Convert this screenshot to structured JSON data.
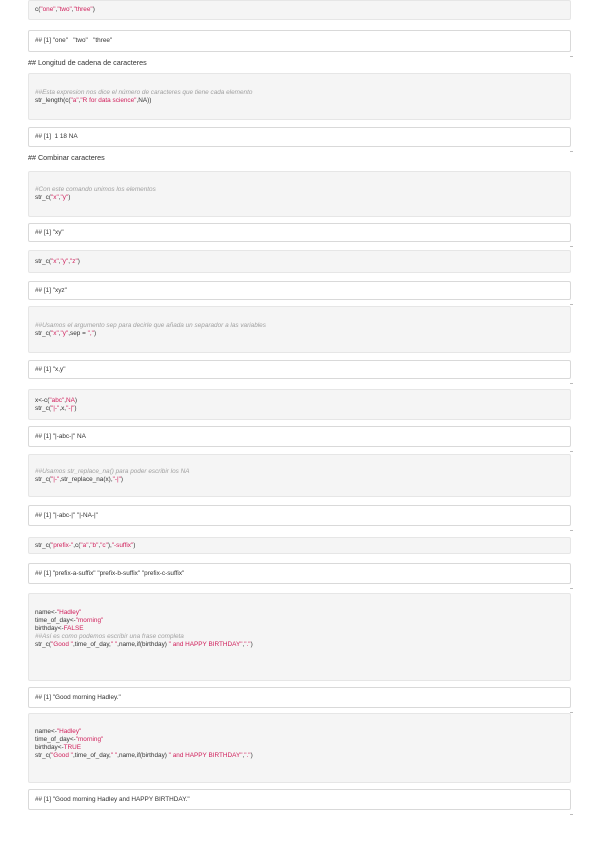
{
  "blocks": [
    {
      "kind": "code",
      "lines": [
        [
          [
            "c(",
            ""
          ],
          [
            "\"one\"",
            "str"
          ],
          [
            ",",
            ""
          ],
          [
            "\"two\"",
            "str"
          ],
          [
            ",",
            ""
          ],
          [
            "\"three\"",
            "str"
          ],
          [
            ")",
            ""
          ]
        ]
      ]
    },
    {
      "kind": "out",
      "lines": [
        [
          [
            "## [1] \"one\"   \"two\"   \"three\"",
            ""
          ]
        ]
      ]
    },
    {
      "kind": "heading",
      "text": "## Longitud de cadena de caracteres"
    },
    {
      "kind": "code",
      "lines": [
        [
          [
            "##Esta expresion nos dice el número de caracteres que tiene cada elemento",
            "cm"
          ]
        ],
        [
          [
            "str_length(c(",
            ""
          ],
          [
            "\"a\"",
            "str"
          ],
          [
            ",",
            ""
          ],
          [
            "\"R for data science\"",
            "str"
          ],
          [
            ",NA))",
            ""
          ]
        ]
      ]
    },
    {
      "kind": "out",
      "lines": [
        [
          [
            "## [1]  1 18 NA",
            ""
          ]
        ]
      ]
    },
    {
      "kind": "heading",
      "text": "## Combinar caracteres"
    },
    {
      "kind": "code",
      "lines": [
        [
          [
            "#Con este comando unimos los elementos",
            "cm"
          ]
        ],
        [
          [
            "str_c(",
            ""
          ],
          [
            "\"x\"",
            "str"
          ],
          [
            ",",
            ""
          ],
          [
            "\"y\"",
            "str"
          ],
          [
            ")",
            ""
          ]
        ]
      ]
    },
    {
      "kind": "out",
      "lines": [
        [
          [
            "## [1] \"xy\"",
            ""
          ]
        ]
      ]
    },
    {
      "kind": "code",
      "lines": [
        [
          [
            "str_c(",
            ""
          ],
          [
            "\"x\"",
            "str"
          ],
          [
            ",",
            ""
          ],
          [
            "\"y\"",
            "str"
          ],
          [
            ",",
            ""
          ],
          [
            "\"z\"",
            "str"
          ],
          [
            ")",
            ""
          ]
        ]
      ]
    },
    {
      "kind": "out",
      "lines": [
        [
          [
            "## [1] \"xyz\"",
            ""
          ]
        ]
      ]
    },
    {
      "kind": "code",
      "lines": [
        [
          [
            "##Usamos el argumento sep para decirle que añada un separador a las variables",
            "cm"
          ]
        ],
        [
          [
            "str_c(",
            ""
          ],
          [
            "\"x\"",
            "str"
          ],
          [
            ",",
            ""
          ],
          [
            "\"y\"",
            "str"
          ],
          [
            ",sep = ",
            ""
          ],
          [
            "\",\"",
            "str"
          ],
          [
            ")",
            ""
          ]
        ]
      ]
    },
    {
      "kind": "out",
      "lines": [
        [
          [
            "## [1] \"x,y\"",
            ""
          ]
        ]
      ]
    },
    {
      "kind": "code",
      "lines": [
        [
          [
            "x<-c(",
            ""
          ],
          [
            "\"abc\"",
            "str"
          ],
          [
            ",",
            ""
          ],
          [
            "NA",
            "kw"
          ],
          [
            ")",
            ""
          ]
        ],
        [
          [
            "str_c(",
            ""
          ],
          [
            "\"|-\"",
            "str"
          ],
          [
            ",x,",
            ""
          ],
          [
            "\"-|\"",
            "str"
          ],
          [
            ")",
            ""
          ]
        ]
      ]
    },
    {
      "kind": "out",
      "lines": [
        [
          [
            "## [1] \"|-abc-|\" NA",
            ""
          ]
        ]
      ]
    },
    {
      "kind": "code",
      "lines": [
        [
          [
            "##Usamos str_replace_na() para poder escribir los NA",
            "cm"
          ]
        ],
        [
          [
            "str_c(",
            ""
          ],
          [
            "\"|-\"",
            "str"
          ],
          [
            ",str_replace_na(x),",
            ""
          ],
          [
            "\"-|\"",
            "str"
          ],
          [
            ")",
            ""
          ]
        ]
      ]
    },
    {
      "kind": "out",
      "lines": [
        [
          [
            "## [1] \"|-abc-|\" \"|-NA-|\"",
            ""
          ]
        ]
      ]
    },
    {
      "kind": "code",
      "lines": [
        [
          [
            "str_c(",
            ""
          ],
          [
            "\"prefix-\"",
            "str"
          ],
          [
            ",c(",
            ""
          ],
          [
            "\"a\"",
            "str"
          ],
          [
            ",",
            ""
          ],
          [
            "\"b\"",
            "str"
          ],
          [
            ",",
            ""
          ],
          [
            "\"c\"",
            "str"
          ],
          [
            "),",
            ""
          ],
          [
            "\"-suffix\"",
            "str"
          ],
          [
            ")",
            ""
          ]
        ]
      ]
    },
    {
      "kind": "out",
      "lines": [
        [
          [
            "## [1] \"prefix-a-suffix\" \"prefix-b-suffix\" \"prefix-c-suffix\"",
            ""
          ]
        ]
      ]
    },
    {
      "kind": "code",
      "lines": [
        [
          [
            "name<-",
            ""
          ],
          [
            "\"Hadley\"",
            "str"
          ]
        ],
        [
          [
            "time_of_day<-",
            ""
          ],
          [
            "\"morning\"",
            "str"
          ]
        ],
        [
          [
            "birthday<-",
            ""
          ],
          [
            "FALSE",
            "kw"
          ]
        ],
        [
          [
            "",
            ""
          ]
        ],
        [
          [
            "##Así es como podemos escribir una frase completa",
            "cm"
          ]
        ],
        [
          [
            "",
            ""
          ]
        ],
        [
          [
            "str_c(",
            ""
          ],
          [
            "\"Good \"",
            "str"
          ],
          [
            ",time_of_day,",
            ""
          ],
          [
            "\" \"",
            "str"
          ],
          [
            ",name,if(birthday) ",
            ""
          ],
          [
            "\" and HAPPY BIRTHDAY\"",
            "str"
          ],
          [
            ",",
            ""
          ],
          [
            "\".\"",
            "str"
          ],
          [
            ")",
            ""
          ]
        ]
      ]
    },
    {
      "kind": "out",
      "lines": [
        [
          [
            "## [1] \"Good morning Hadley.\"",
            ""
          ]
        ]
      ]
    },
    {
      "kind": "code",
      "lines": [
        [
          [
            "name<-",
            ""
          ],
          [
            "\"Hadley\"",
            "str"
          ]
        ],
        [
          [
            "time_of_day<-",
            ""
          ],
          [
            "\"morning\"",
            "str"
          ]
        ],
        [
          [
            "birthday<-",
            ""
          ],
          [
            "TRUE",
            "kw"
          ]
        ],
        [
          [
            "",
            ""
          ]
        ],
        [
          [
            "str_c(",
            ""
          ],
          [
            "\"Good \"",
            "str"
          ],
          [
            ",time_of_day,",
            ""
          ],
          [
            "\" \"",
            "str"
          ],
          [
            ",name,if(birthday) ",
            ""
          ],
          [
            "\" and HAPPY BIRTHDAY\"",
            "str"
          ],
          [
            ",",
            ""
          ],
          [
            "\".\"",
            "str"
          ],
          [
            ")",
            ""
          ]
        ]
      ]
    },
    {
      "kind": "out",
      "lines": [
        [
          [
            "## [1] \"Good morning Hadley and HAPPY BIRTHDAY.\"",
            ""
          ]
        ]
      ]
    }
  ]
}
